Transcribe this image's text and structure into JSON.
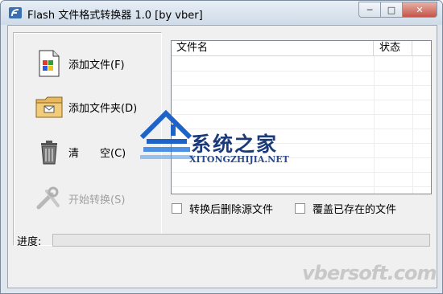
{
  "window": {
    "title": "Flash 文件格式转换器 1.0 [by vber]",
    "minimize_icon": "minimize-icon",
    "maximize_icon": "maximize-icon",
    "close_icon": "close-icon"
  },
  "actions": {
    "add_file": "添加文件(F)",
    "add_folder": "添加文件夹(D)",
    "clear": "清　　空(C)",
    "start": "开始转换(S)"
  },
  "list": {
    "col_filename": "文件名",
    "col_status": "状态"
  },
  "options": {
    "delete_source": "转换后删除源文件",
    "overwrite": "覆盖已存在的文件"
  },
  "progress": {
    "label": "进度:",
    "value": 0
  },
  "watermark": {
    "title": "系统之家",
    "subtitle": "XITONGZHIJIA.NET",
    "site": "vbersoft.com"
  }
}
